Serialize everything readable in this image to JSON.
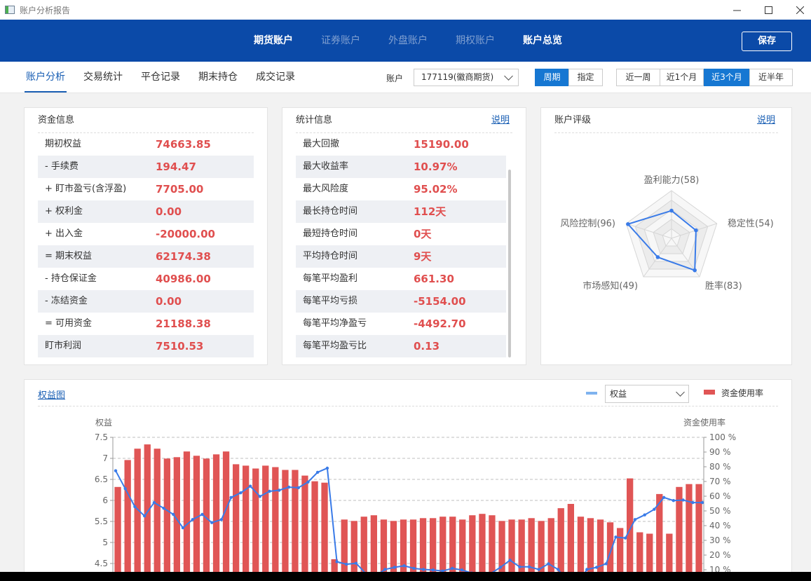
{
  "window": {
    "title": "账户分析报告",
    "minimize_icon": "minimize-icon",
    "maximize_icon": "maximize-icon",
    "close_icon": "close-icon"
  },
  "nav": {
    "tabs": [
      {
        "label": "期货账户",
        "active": true
      },
      {
        "label": "证券账户",
        "active": false
      },
      {
        "label": "外盘账户",
        "active": false
      },
      {
        "label": "期权账户",
        "active": false
      },
      {
        "label": "账户总览",
        "active": true
      }
    ],
    "save_label": "保存"
  },
  "subnav": {
    "tabs": [
      "账户分析",
      "交易统计",
      "平仓记录",
      "期末持仓",
      "成交记录"
    ],
    "account_label": "账户",
    "account_value": "177119(徽商期货)",
    "mode_buttons": [
      {
        "label": "周期",
        "active": true
      },
      {
        "label": "指定",
        "active": false
      }
    ],
    "range_buttons": [
      {
        "label": "近一周",
        "active": false
      },
      {
        "label": "近1个月",
        "active": false
      },
      {
        "label": "近3个月",
        "active": true
      },
      {
        "label": "近半年",
        "active": false
      }
    ]
  },
  "funds": {
    "title": "资金信息",
    "rows": [
      {
        "label": "期初权益",
        "value": "74663.85"
      },
      {
        "label": "-  手续费",
        "value": "194.47"
      },
      {
        "label": "+ 盯市盈亏(含浮盈)",
        "value": "7705.00"
      },
      {
        "label": "+ 权利金",
        "value": "0.00"
      },
      {
        "label": "+ 出入金",
        "value": "-20000.00"
      },
      {
        "label": "= 期末权益",
        "value": "62174.38"
      },
      {
        "label": "-  持仓保证金",
        "value": "40986.00"
      },
      {
        "label": "-  冻结资金",
        "value": "0.00"
      },
      {
        "label": "= 可用资金",
        "value": "21188.38"
      },
      {
        "label": "盯市利润",
        "value": "7510.53"
      }
    ]
  },
  "stats": {
    "title": "统计信息",
    "link": "说明",
    "rows": [
      {
        "label": "最大回撤",
        "value": "15190.00"
      },
      {
        "label": "最大收益率",
        "value": "10.97%"
      },
      {
        "label": "最大风险度",
        "value": "95.02%"
      },
      {
        "label": "最长持仓时间",
        "value": "112天"
      },
      {
        "label": "最短持仓时间",
        "value": "0天"
      },
      {
        "label": "平均持仓时间",
        "value": "9天"
      },
      {
        "label": "每笔平均盈利",
        "value": "661.30"
      },
      {
        "label": "每笔平均亏损",
        "value": "-5154.00"
      },
      {
        "label": "每笔平均净盈亏",
        "value": "-4492.70"
      },
      {
        "label": "每笔平均盈亏比",
        "value": "0.13"
      }
    ]
  },
  "rating": {
    "title": "账户评级",
    "link": "说明",
    "radar": [
      {
        "label": "盈利能力(58)",
        "value": 58
      },
      {
        "label": "稳定性(54)",
        "value": 54
      },
      {
        "label": "胜率(83)",
        "value": 83
      },
      {
        "label": "市场感知(49)",
        "value": 49
      },
      {
        "label": "风险控制(96)",
        "value": 96
      }
    ],
    "max": 100,
    "line_color": "#3a7be8"
  },
  "equity": {
    "title": "权益图",
    "select_value": "权益",
    "legend_line_label": "",
    "legend_bar_label": "资金使用率",
    "line_color": "#3a7be8",
    "bar_color": "#e05555"
  },
  "chart_data": {
    "type": "bar",
    "ylabel": "权益",
    "y2label": "资金使用率",
    "ylim": [
      4.5,
      7.5
    ],
    "y_ticks": [
      "7.5",
      "7",
      "6.5",
      "6",
      "5.5",
      "5",
      "4.5"
    ],
    "y2_ticks": [
      "100 %",
      "90 %",
      "80 %",
      "70 %",
      "60 %",
      "50 %",
      "40 %",
      "30 %",
      "20 %",
      "10 %"
    ],
    "y2lim": [
      10,
      100
    ],
    "grid": true,
    "series": [
      {
        "name": "资金使用率",
        "type": "bar",
        "values": [
          65,
          84,
          92,
          95,
          92,
          85,
          86,
          90,
          87,
          85,
          88,
          90,
          81,
          80,
          78,
          80,
          79,
          77,
          77,
          73,
          69,
          68,
          14,
          42,
          41,
          44,
          45,
          42,
          41,
          42,
          42,
          43,
          43,
          44,
          44,
          42,
          45,
          46,
          45,
          41,
          42,
          42,
          43,
          41,
          43,
          50,
          53,
          44,
          43,
          42,
          40,
          36,
          71,
          33,
          32,
          60,
          32,
          65,
          67,
          67
        ]
      },
      {
        "name": "权益",
        "type": "line",
        "values": [
          6.85,
          6.5,
          6.15,
          5.97,
          6.23,
          6.12,
          6.0,
          5.74,
          5.9,
          6.0,
          5.84,
          5.9,
          6.33,
          6.42,
          6.55,
          6.35,
          6.45,
          6.47,
          6.53,
          6.52,
          6.63,
          6.82,
          6.9,
          5.08,
          5.03,
          5.05,
          4.85,
          4.8,
          4.93,
          4.97,
          5.0,
          4.95,
          4.93,
          4.92,
          4.9,
          4.95,
          4.92,
          4.86,
          4.8,
          4.85,
          4.97,
          5.11,
          4.98,
          4.98,
          4.93,
          5.04,
          4.93,
          4.7,
          4.6,
          4.93,
          4.97,
          5.04,
          5.56,
          5.54,
          5.9,
          5.99,
          6.1,
          6.33,
          6.27,
          6.28,
          6.23,
          6.23
        ]
      }
    ]
  }
}
